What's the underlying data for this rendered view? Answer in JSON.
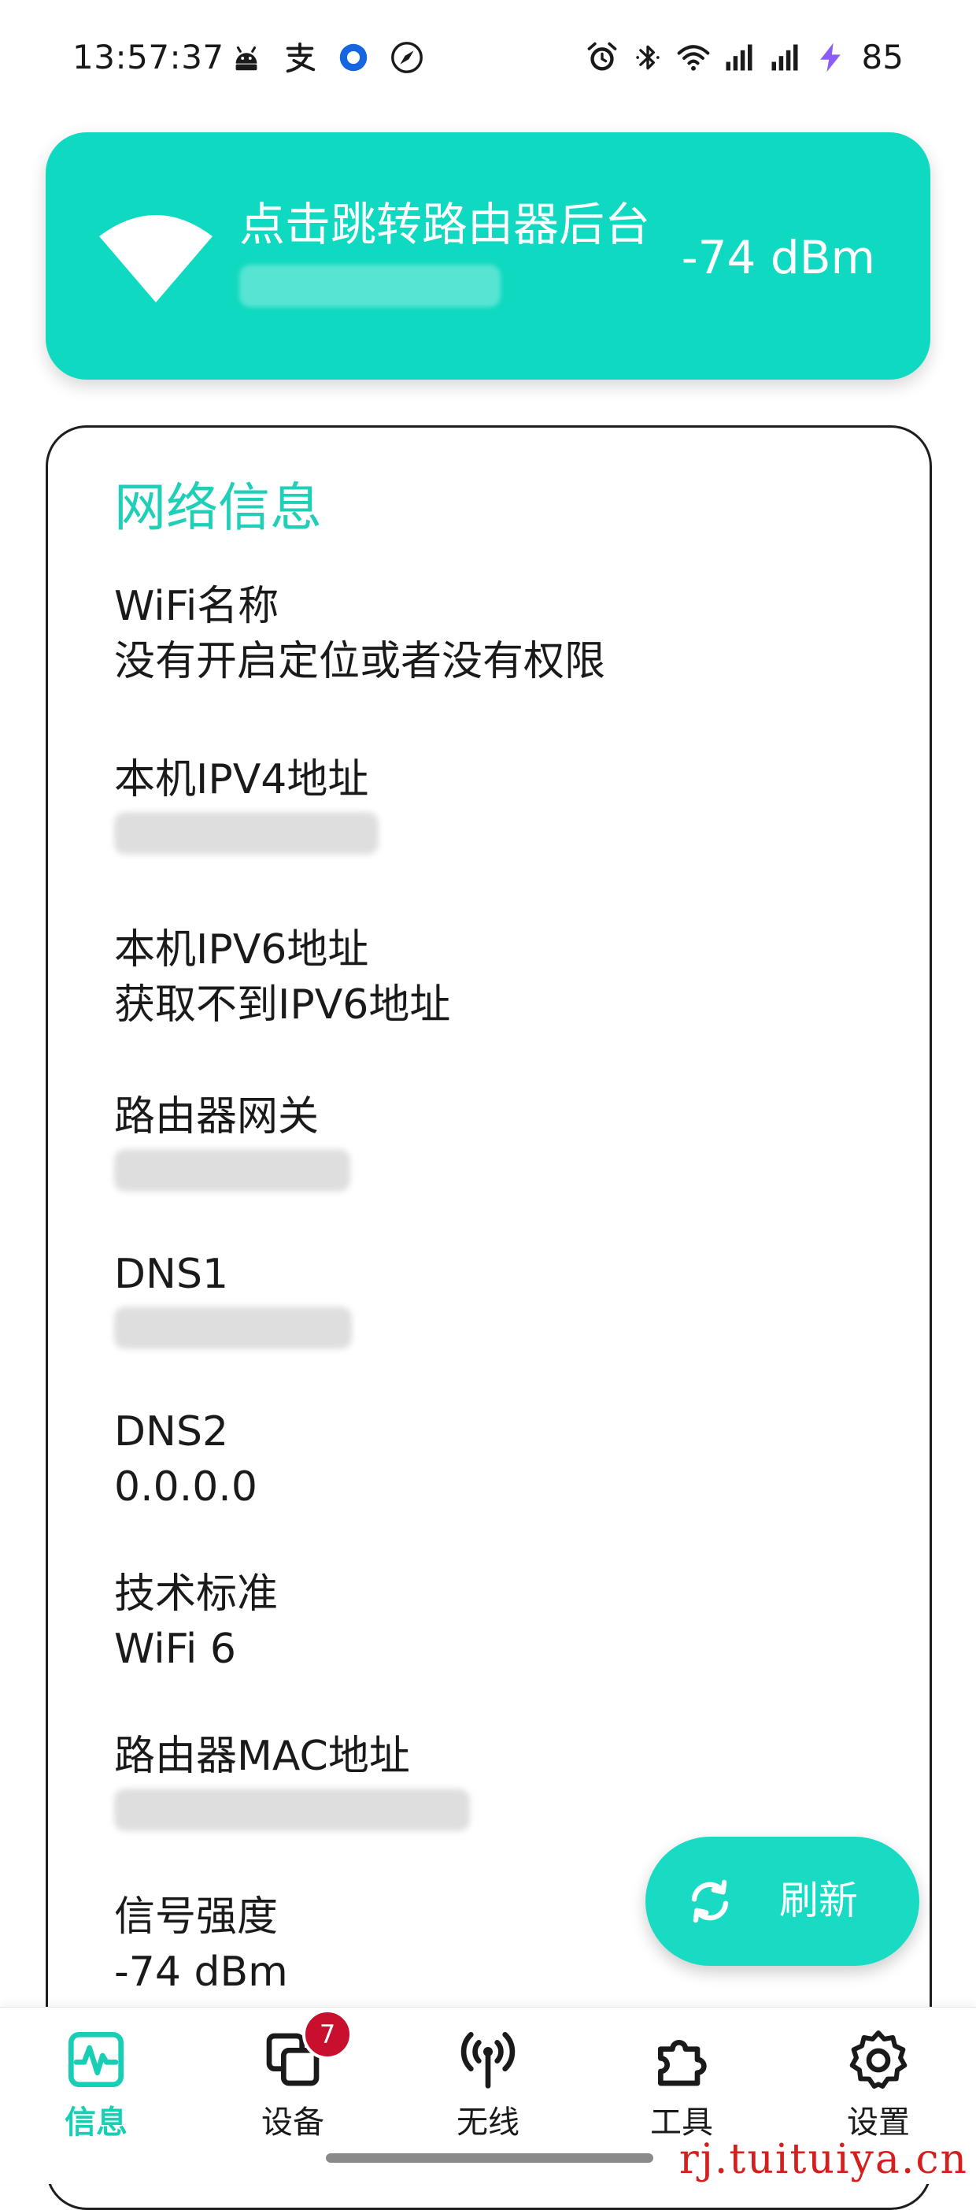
{
  "status_bar": {
    "time": "13:57:37",
    "left_icons": [
      "android-icon",
      "alipay-icon",
      "app-ring-icon",
      "compass-icon"
    ],
    "right_icons": [
      "alarm-icon",
      "bluetooth-icon",
      "wifi-icon",
      "cell-signal-1-icon",
      "cell-signal-2-icon",
      "charging-bolt-icon"
    ],
    "battery_level": "85"
  },
  "banner": {
    "title": "点击跳转路由器后台",
    "signal": "-74 dBm",
    "background_color": "#0fd9c0"
  },
  "network_info": {
    "title": "网络信息",
    "items": [
      {
        "label": "WiFi名称",
        "value": "没有开启定位或者没有权限"
      },
      {
        "label": "本机IPV4地址",
        "value": null
      },
      {
        "label": "本机IPV6地址",
        "value": "获取不到IPV6地址"
      },
      {
        "label": "路由器网关",
        "value": null
      },
      {
        "label": "DNS1",
        "value": null
      },
      {
        "label": "DNS2",
        "value": "0.0.0.0"
      },
      {
        "label": "技术标准",
        "value": "WiFi 6"
      },
      {
        "label": "路由器MAC地址",
        "value": null
      },
      {
        "label": "信号强度",
        "value": "-74 dBm"
      }
    ]
  },
  "refresh_button": {
    "label": "刷新",
    "icon": "refresh-icon"
  },
  "bottom_nav": {
    "items": [
      {
        "label": "信息",
        "icon": "activity-icon",
        "active": true
      },
      {
        "label": "设备",
        "icon": "devices-icon",
        "badge": "7"
      },
      {
        "label": "无线",
        "icon": "antenna-icon"
      },
      {
        "label": "工具",
        "icon": "puzzle-icon"
      },
      {
        "label": "设置",
        "icon": "gear-icon"
      }
    ]
  },
  "theme": {
    "accent": "#1fcfb8",
    "badge": "#c8102e"
  },
  "watermark": "rj.tuituiya.cn"
}
